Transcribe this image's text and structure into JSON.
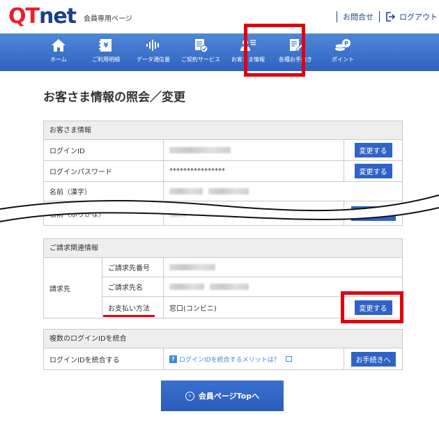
{
  "header": {
    "logo_q": "QT",
    "logo_net": "net",
    "member_label": "会員専用ページ",
    "contact_label": "お問合せ",
    "logout_label": "ログアウト"
  },
  "nav": {
    "items": [
      {
        "label": "ホーム",
        "icon": "home-icon"
      },
      {
        "label": "ご利用明細",
        "icon": "statement-icon"
      },
      {
        "label": "データ通信量",
        "icon": "data-usage-icon"
      },
      {
        "label": "ご契約サービス",
        "icon": "contract-icon"
      },
      {
        "label": "お客さま情報",
        "icon": "customer-info-icon"
      },
      {
        "label": "各種お手続き",
        "icon": "procedure-icon"
      },
      {
        "label": "ポイント",
        "icon": "point-icon"
      }
    ]
  },
  "page_title": "お客さま情報の照会／変更",
  "customer_info": {
    "heading": "お客さま情報",
    "rows": [
      {
        "label": "ログインID",
        "value": "",
        "button": "変更する"
      },
      {
        "label": "ログインパスワード",
        "value": "****************",
        "button": "変更する"
      },
      {
        "label": "名前（漢字）",
        "value": "",
        "button": ""
      },
      {
        "label": "名前（ふりがな）",
        "value": "",
        "button": "履歴を見る"
      }
    ]
  },
  "billing": {
    "heading": "ご請求関連情報",
    "group_label": "請求先",
    "rows": [
      {
        "label": "ご請求先番号",
        "value": "",
        "button": ""
      },
      {
        "label": "ご請求先名",
        "value": "",
        "button": ""
      },
      {
        "label": "お支払い方法",
        "value": "窓口(コンビニ)",
        "button": "変更する"
      }
    ]
  },
  "merge": {
    "heading": "複数のログインIDを統合",
    "label": "ログインIDを統合する",
    "help_link": "ログインIDを統合するメリットは？",
    "button": "お手続きへ"
  },
  "top_button": "会員ページTopへ",
  "colors": {
    "brand_red": "#e8202a",
    "brand_navy": "#1d3f8a",
    "nav_blue": "#3a6fcc",
    "button_blue": "#2f64c6",
    "highlight_red": "#e00010"
  }
}
